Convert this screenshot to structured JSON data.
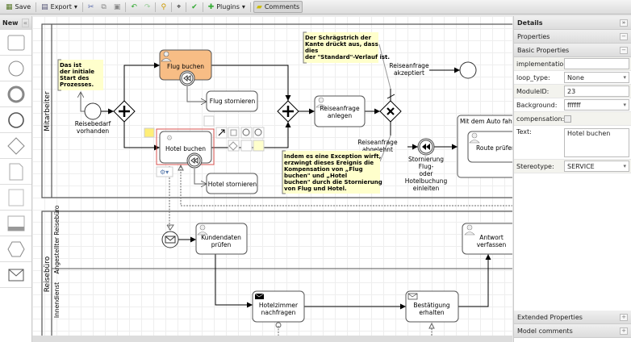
{
  "toolbar": {
    "save": "Save",
    "export": "Export",
    "plugins": "Plugins",
    "comments": "Comments"
  },
  "palette": {
    "title": "New",
    "items": [
      "task",
      "start-event",
      "intermediate-event",
      "end-event",
      "gateway",
      "data-object",
      "text-annotation",
      "pool",
      "conversation",
      "message"
    ]
  },
  "diagram": {
    "pool1": "Mitarbeiter",
    "pool2": "Reisebüro",
    "lane1": "Angestellter Reisebüro",
    "lane2": "Innendienst",
    "start_label": [
      "Reisebedarf",
      "vorhanden"
    ],
    "note1": [
      "Das ist",
      "der initiale",
      "Start des",
      "Prozesses."
    ],
    "flug_buchen": "Flug buchen",
    "flug_stornieren": "Flug stornieren",
    "hotel_buchen": "Hotel buchen",
    "hotel_stornieren": "Hotel stornieren",
    "reiseanfrage_anlegen": [
      "Reiseanfrage",
      "anlegen"
    ],
    "note2": [
      "Der Schrägstrich der",
      "Kante drückt aus, dass",
      "dies",
      "der \"Standard\"-Verlauf ist."
    ],
    "akzeptiert": [
      "Reiseanfrage",
      "akzeptiert"
    ],
    "abgelehnt": [
      "Reiseanfrage",
      "abgelehnt"
    ],
    "note3": [
      "Indem es eine Exception wirft,",
      "erzwingt dieses Ereignis die",
      "Kompensation von „Flug",
      "buchen\" und „Hotel",
      "buchen\" durch die Stornierung",
      "von Flug und Hotel."
    ],
    "stornierung": [
      "Stornierung",
      "Flug-",
      "oder",
      "Hotelbuchung",
      "einleiten"
    ],
    "subprocess": "Mit dem Auto fahren",
    "route": "Route prüfen",
    "kundendaten": [
      "Kundendaten",
      "prüfen"
    ],
    "antwort": [
      "Antwort",
      "verfassen"
    ],
    "hotelzimmer": [
      "Hotelzimmer",
      "nachfragen"
    ],
    "bestaetigung": [
      "Bestätigung",
      "erhalten"
    ],
    "colors": {
      "selected_task": "#f7bd85",
      "annotation": "#ffffcc",
      "selection": "#d9534f"
    }
  },
  "panel": {
    "title": "Details",
    "properties": "Properties",
    "basic": "Basic Properties",
    "fields": {
      "implementation": {
        "label": "implementation:",
        "value": ""
      },
      "loop_type": {
        "label": "loop_type:",
        "value": "None"
      },
      "module_id": {
        "label": "ModuleID:",
        "value": "23"
      },
      "background": {
        "label": "Background:",
        "value": "ffffff"
      },
      "compensation": {
        "label": "compensation:",
        "value": false
      },
      "text": {
        "label": "Text:",
        "value": "Hotel buchen"
      },
      "stereotype": {
        "label": "Stereotype:",
        "value": "SERVICE"
      }
    },
    "extended": "Extended Properties",
    "comments": "Model comments"
  }
}
